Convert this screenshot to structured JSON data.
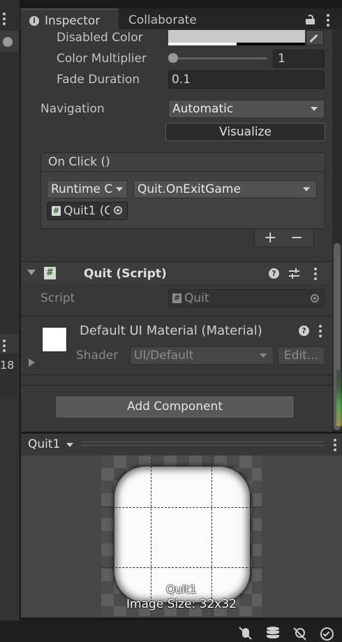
{
  "window": {
    "tabs": [
      {
        "label": "Inspector",
        "active": true
      },
      {
        "label": "Collaborate",
        "active": false
      }
    ]
  },
  "left_panel": {
    "number": "18"
  },
  "button_component": {
    "disabled_color": {
      "label": "Disabled Color",
      "value": "#c8c8c8"
    },
    "color_multiplier": {
      "label": "Color Multiplier",
      "value": "1",
      "slider_fraction": 0
    },
    "fade_duration": {
      "label": "Fade Duration",
      "value": "0.1"
    },
    "navigation": {
      "label": "Navigation",
      "selected": "Automatic"
    },
    "visualize_label": "Visualize",
    "on_click": {
      "header": "On Click ()",
      "runtime_selected": "Runtime C",
      "function_selected": "Quit.OnExitGame",
      "object_ref": "Quit1 (C",
      "add_label": "+",
      "remove_label": "−"
    }
  },
  "quit_script": {
    "title": "Quit (Script)",
    "script_label": "Script",
    "script_value": "Quit"
  },
  "material": {
    "title": "Default UI Material (Material)",
    "shader_label": "Shader",
    "shader_value": "UI/Default",
    "edit_label": "Edit..."
  },
  "add_component_label": "Add Component",
  "preview": {
    "object_name": "Quit1",
    "image_name": "Quit1",
    "image_size": "Image Size: 32x32"
  },
  "colors": {
    "panel": "#383838",
    "field": "#2a2a2a",
    "button": "#585858",
    "accent_green": "#45c845"
  }
}
